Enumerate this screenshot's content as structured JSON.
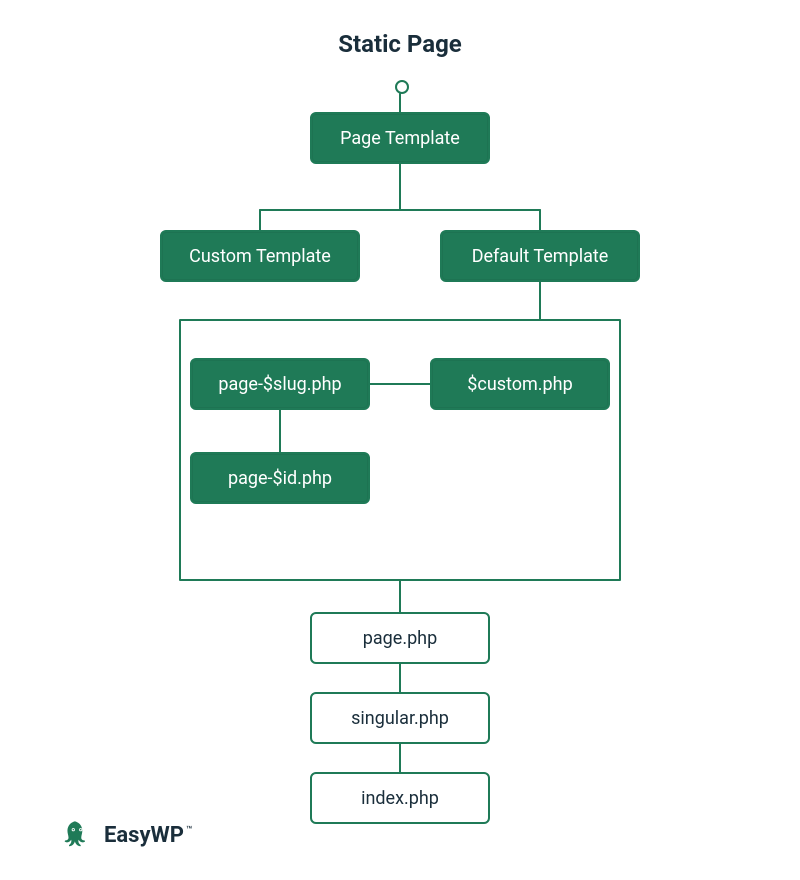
{
  "title": "Static Page",
  "nodes": {
    "page_template": {
      "label": "Page Template",
      "kind": "solid"
    },
    "custom_template": {
      "label": "Custom Template",
      "kind": "solid"
    },
    "default_template": {
      "label": "Default Template",
      "kind": "solid"
    },
    "page_slug": {
      "label": "page-$slug.php",
      "kind": "solid"
    },
    "custom_php": {
      "label": "$custom.php",
      "kind": "solid"
    },
    "page_id": {
      "label": "page-$id.php",
      "kind": "solid"
    },
    "page_php": {
      "label": "page.php",
      "kind": "outline"
    },
    "singular_php": {
      "label": "singular.php",
      "kind": "outline"
    },
    "index_php": {
      "label": "index.php",
      "kind": "outline"
    }
  },
  "brand": {
    "name": "EasyWP",
    "tm": "™"
  },
  "colors": {
    "brand_green": "#1f7a57",
    "text_dark": "#1a2e3b"
  }
}
